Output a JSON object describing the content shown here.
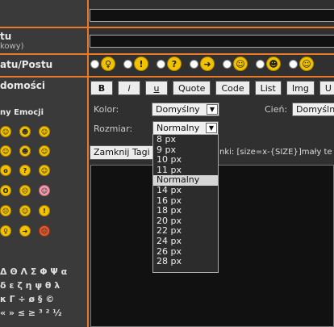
{
  "left": {
    "topic_label_partial": "tu",
    "topic_sub_partial": "kowy)",
    "icon_label_partial": "atu/Postu",
    "message_label_partial": "domości",
    "emoticons_label_partial": "ny Emocji",
    "emoticons": [
      "smile-icon",
      "grin-icon",
      "laugh-icon",
      "wink-icon",
      "cool-icon",
      "biggrin-icon",
      "surprised-icon",
      "confused-icon",
      "cheesy-icon",
      "shocked-icon",
      "sad-icon",
      "blush-icon",
      "angry-icon",
      "rolleyes-icon",
      "exclaim-icon",
      "idea-icon",
      "arrow-icon",
      "mad-icon"
    ],
    "special_chars": [
      "Δ Θ Λ Σ Φ Ψ α",
      "δ ε ζ η ψ θ λ",
      "κ Γ ÷ ø § ©",
      "« » ≤ ≥ ³ ² ½"
    ]
  },
  "post_icons": [
    "idea-icon",
    "exclaim-icon",
    "question-icon",
    "arrow-icon",
    "cool-icon",
    "grin-icon",
    "smile-icon"
  ],
  "toolbar": [
    "B",
    "i",
    "u",
    "Quote",
    "Code",
    "List",
    "Img",
    "U"
  ],
  "color": {
    "label": "Kolor:",
    "value": "Domyślny"
  },
  "shadow": {
    "label": "Cień:",
    "value": "Domyśln"
  },
  "size": {
    "label": "Rozmiar:",
    "value": "Normalny",
    "options": [
      "8 px",
      "9 px",
      "10 px",
      "11 px",
      "Normalny",
      "14 px",
      "16 px",
      "18 px",
      "20 px",
      "22 px",
      "24 px",
      "26 px",
      "28 px"
    ],
    "selected_index": 4
  },
  "close_tags_label": "Zamknij Tagi",
  "hint_text": "nki: [size=x-{SIZE}]mały te"
}
